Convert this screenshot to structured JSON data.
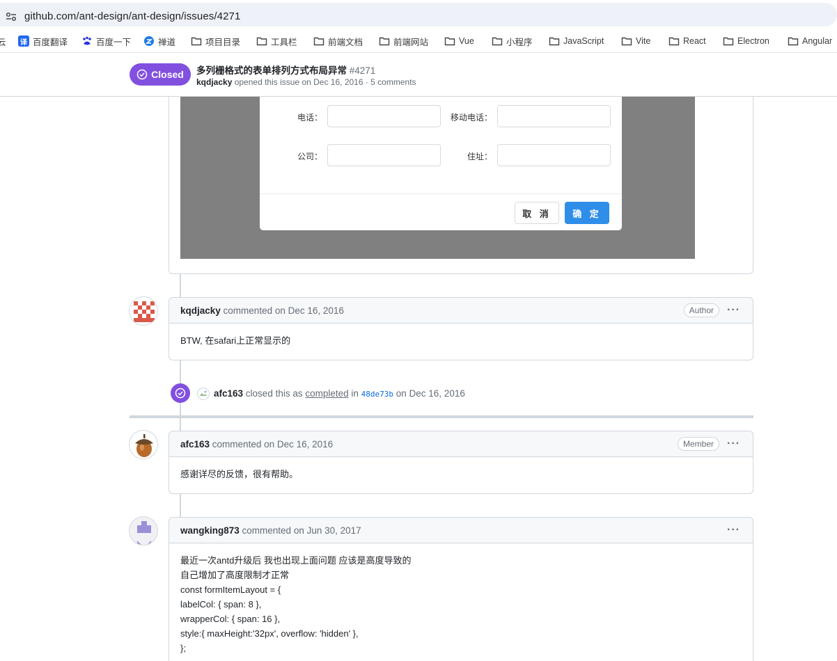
{
  "browser": {
    "url": "github.com/ant-design/ant-design/issues/4271"
  },
  "bookmarks": [
    {
      "label": "云",
      "icon": "partial-icon"
    },
    {
      "label": "百度翻译",
      "icon": "translate-icon"
    },
    {
      "label": "百度一下",
      "icon": "baidu-paw-icon"
    },
    {
      "label": "禅道",
      "icon": "zentao-icon"
    },
    {
      "label": "项目目录",
      "icon": "folder-icon"
    },
    {
      "label": "工具栏",
      "icon": "folder-icon"
    },
    {
      "label": "前端文档",
      "icon": "folder-icon"
    },
    {
      "label": "前端网站",
      "icon": "folder-icon"
    },
    {
      "label": "Vue",
      "icon": "folder-icon"
    },
    {
      "label": "小程序",
      "icon": "folder-icon"
    },
    {
      "label": "JavaScript",
      "icon": "folder-icon"
    },
    {
      "label": "Vite",
      "icon": "folder-icon"
    },
    {
      "label": "React",
      "icon": "folder-icon"
    },
    {
      "label": "Electron",
      "icon": "folder-icon"
    },
    {
      "label": "Angular",
      "icon": "folder-icon"
    }
  ],
  "issue": {
    "state": "Closed",
    "title": "多列栅格式的表单排列方式布局异常",
    "number": "#4271",
    "author": "kqdjacky",
    "meta_rest": " opened this issue on Dec 16, 2016 · 5 comments"
  },
  "screenshot_form": {
    "phone_label": "电话：",
    "mobile_label": "移动电话：",
    "company_label": "公司：",
    "address_label": "住址：",
    "cancel": "取 消",
    "ok": "确 定"
  },
  "comments": [
    {
      "author": "kqdjacky",
      "action": " commented on Dec 16, 2016",
      "role": "Author",
      "more": "···",
      "body": [
        "BTW, 在safari上正常显示的"
      ]
    },
    {
      "author": "afc163",
      "action": " commented on Dec 16, 2016",
      "role": "Member",
      "more": "···",
      "body": [
        "感谢详尽的反馈，很有帮助。"
      ]
    },
    {
      "author": "wangking873",
      "action": " commented on Jun 30, 2017",
      "more": "···",
      "body": [
        "最近一次antd升级后 我也出现上面问题 应该是高度导致的",
        "自己增加了高度限制才正常",
        "const formItemLayout = {",
        "labelCol: { span: 8 },",
        "wrapperCol: { span: 16 },",
        "style:{ maxHeight:'32px', overflow: 'hidden' },",
        "};"
      ]
    }
  ],
  "closed_event": {
    "actor": "afc163",
    "text1": " closed this as ",
    "link": "completed",
    "text2": " in ",
    "commit": "48de73b",
    "text3": "  on Dec 16, 2016"
  },
  "colors": {
    "closed_purple": "#8250df",
    "border": "#d0d7de",
    "ant_primary": "#2f8ee8"
  }
}
